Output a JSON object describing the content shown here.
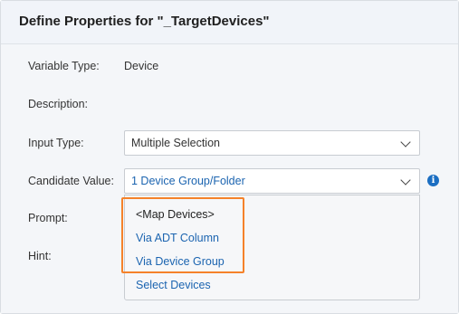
{
  "header": {
    "title": "Define Properties for \"_TargetDevices\""
  },
  "form": {
    "variable_type": {
      "label": "Variable Type:",
      "value": "Device"
    },
    "description": {
      "label": "Description:"
    },
    "input_type": {
      "label": "Input Type:",
      "value": "Multiple Selection"
    },
    "candidate_value": {
      "label": "Candidate Value:",
      "value": "1 Device Group/Folder"
    },
    "prompt": {
      "label": "Prompt:"
    },
    "hint": {
      "label": "Hint:"
    }
  },
  "dropdown": {
    "items": [
      {
        "label": "<Map Devices>"
      },
      {
        "label": "Via ADT Column"
      },
      {
        "label": "Via Device Group"
      },
      {
        "label": "Select Devices"
      }
    ]
  },
  "icons": {
    "info": "info-icon",
    "chevron": "chevron-down-icon"
  },
  "colors": {
    "highlight": "#f5822a",
    "link": "#1b64b0",
    "header_bg": "#f1f4f9",
    "body_bg": "#f4f6f9"
  }
}
